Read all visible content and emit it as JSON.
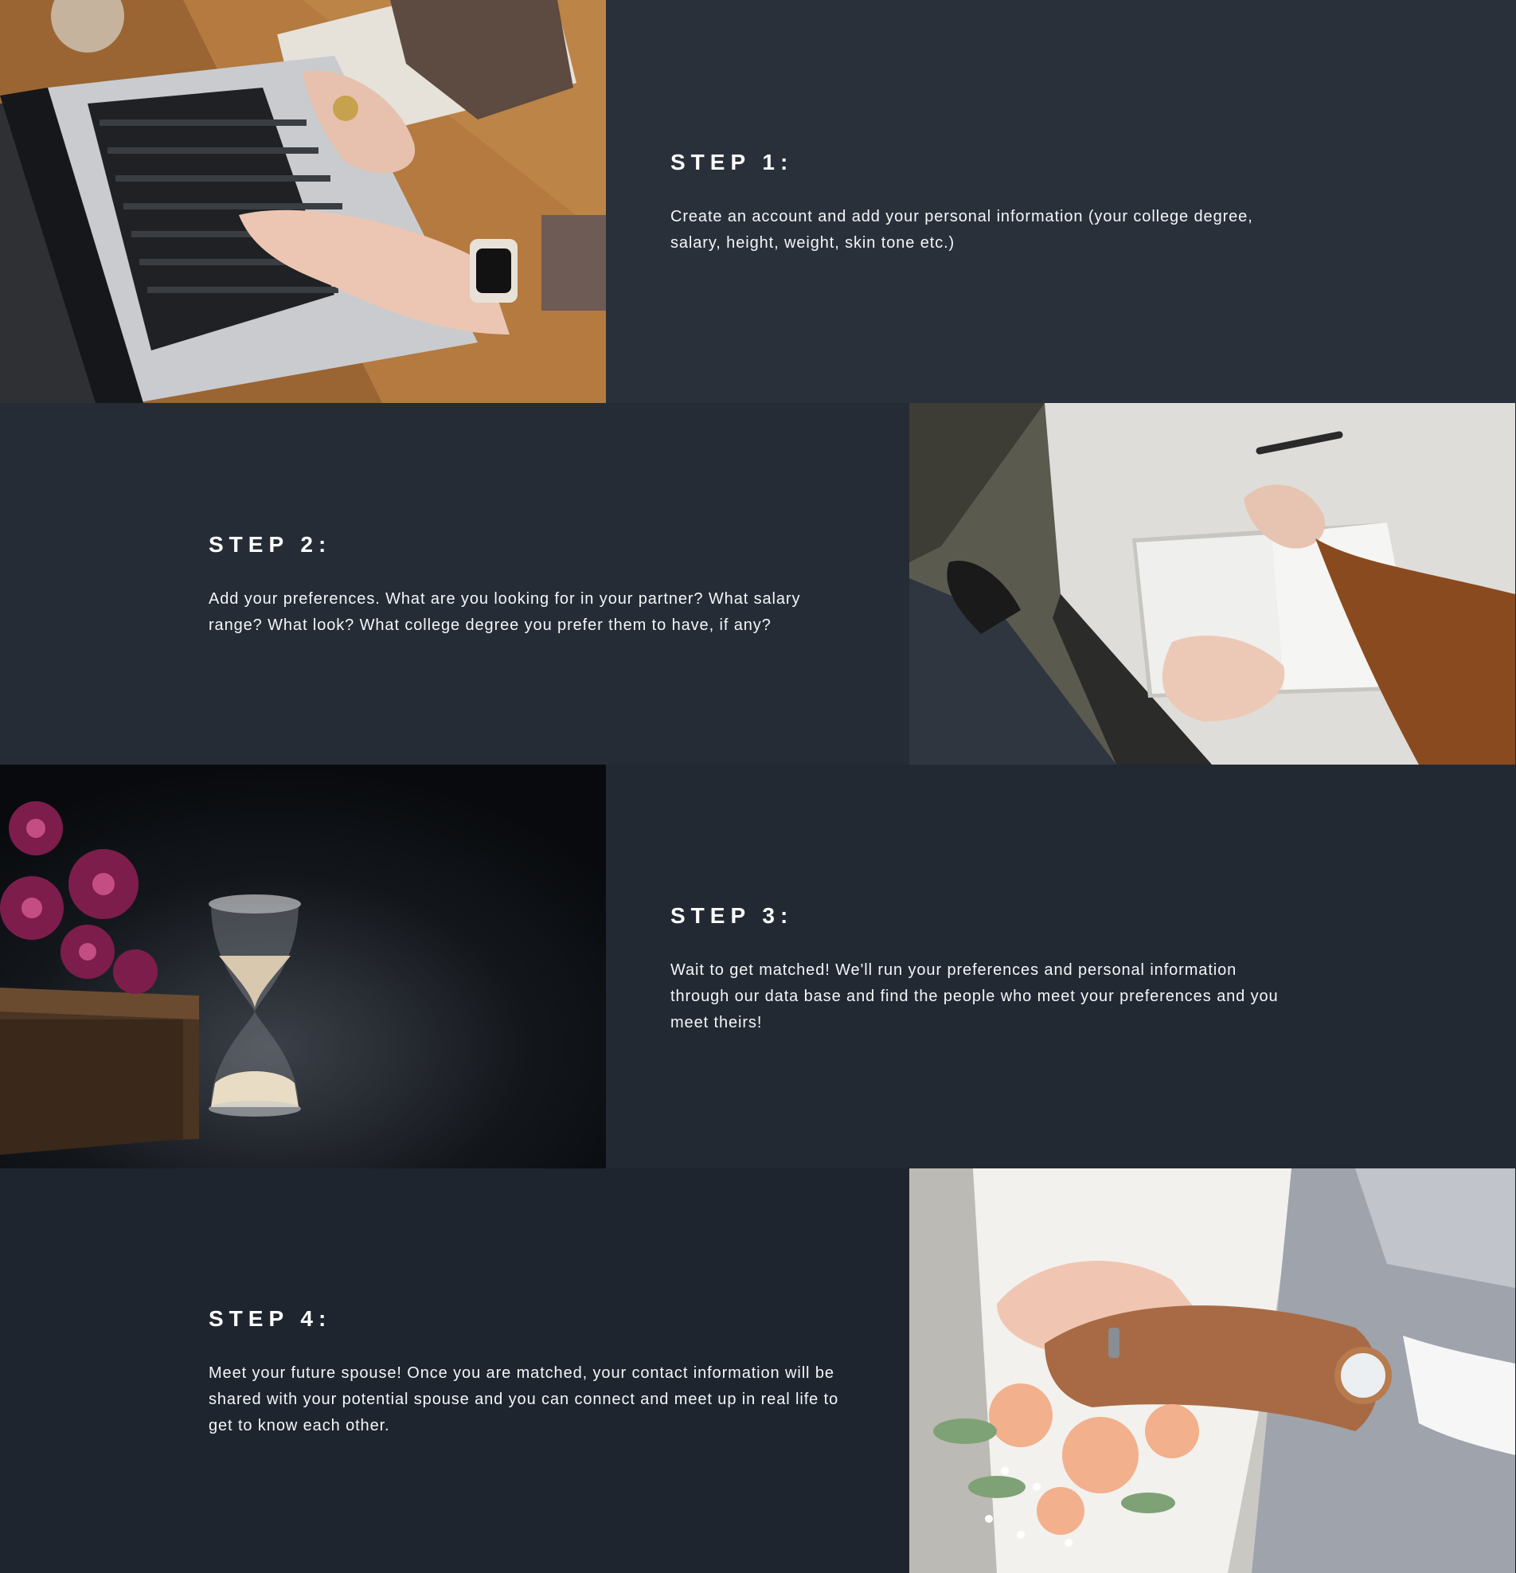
{
  "steps": [
    {
      "title": "STEP 1:",
      "description": "Create an account and add your personal information (your college degree, salary, height, weight, skin tone etc.)",
      "image": "laptop-typing-photo"
    },
    {
      "title": "STEP 2:",
      "description": "Add your preferences. What are you looking for in your partner? What salary range? What look? What college degree you prefer them to have, if any?",
      "image": "writing-notebook-photo"
    },
    {
      "title": "STEP 3:",
      "description": "Wait to get matched! We'll run your preferences and personal information through our data base and find the people who meet your preferences and you meet theirs!",
      "image": "hourglass-photo"
    },
    {
      "title": "STEP 4:",
      "description": "Meet your future spouse! Once you are matched, your contact information will be shared with your potential spouse and you can connect and meet up in real life to get to know each other.",
      "image": "wedding-hands-photo"
    }
  ],
  "colors": {
    "background": "#232b35",
    "text": "#ffffff"
  }
}
